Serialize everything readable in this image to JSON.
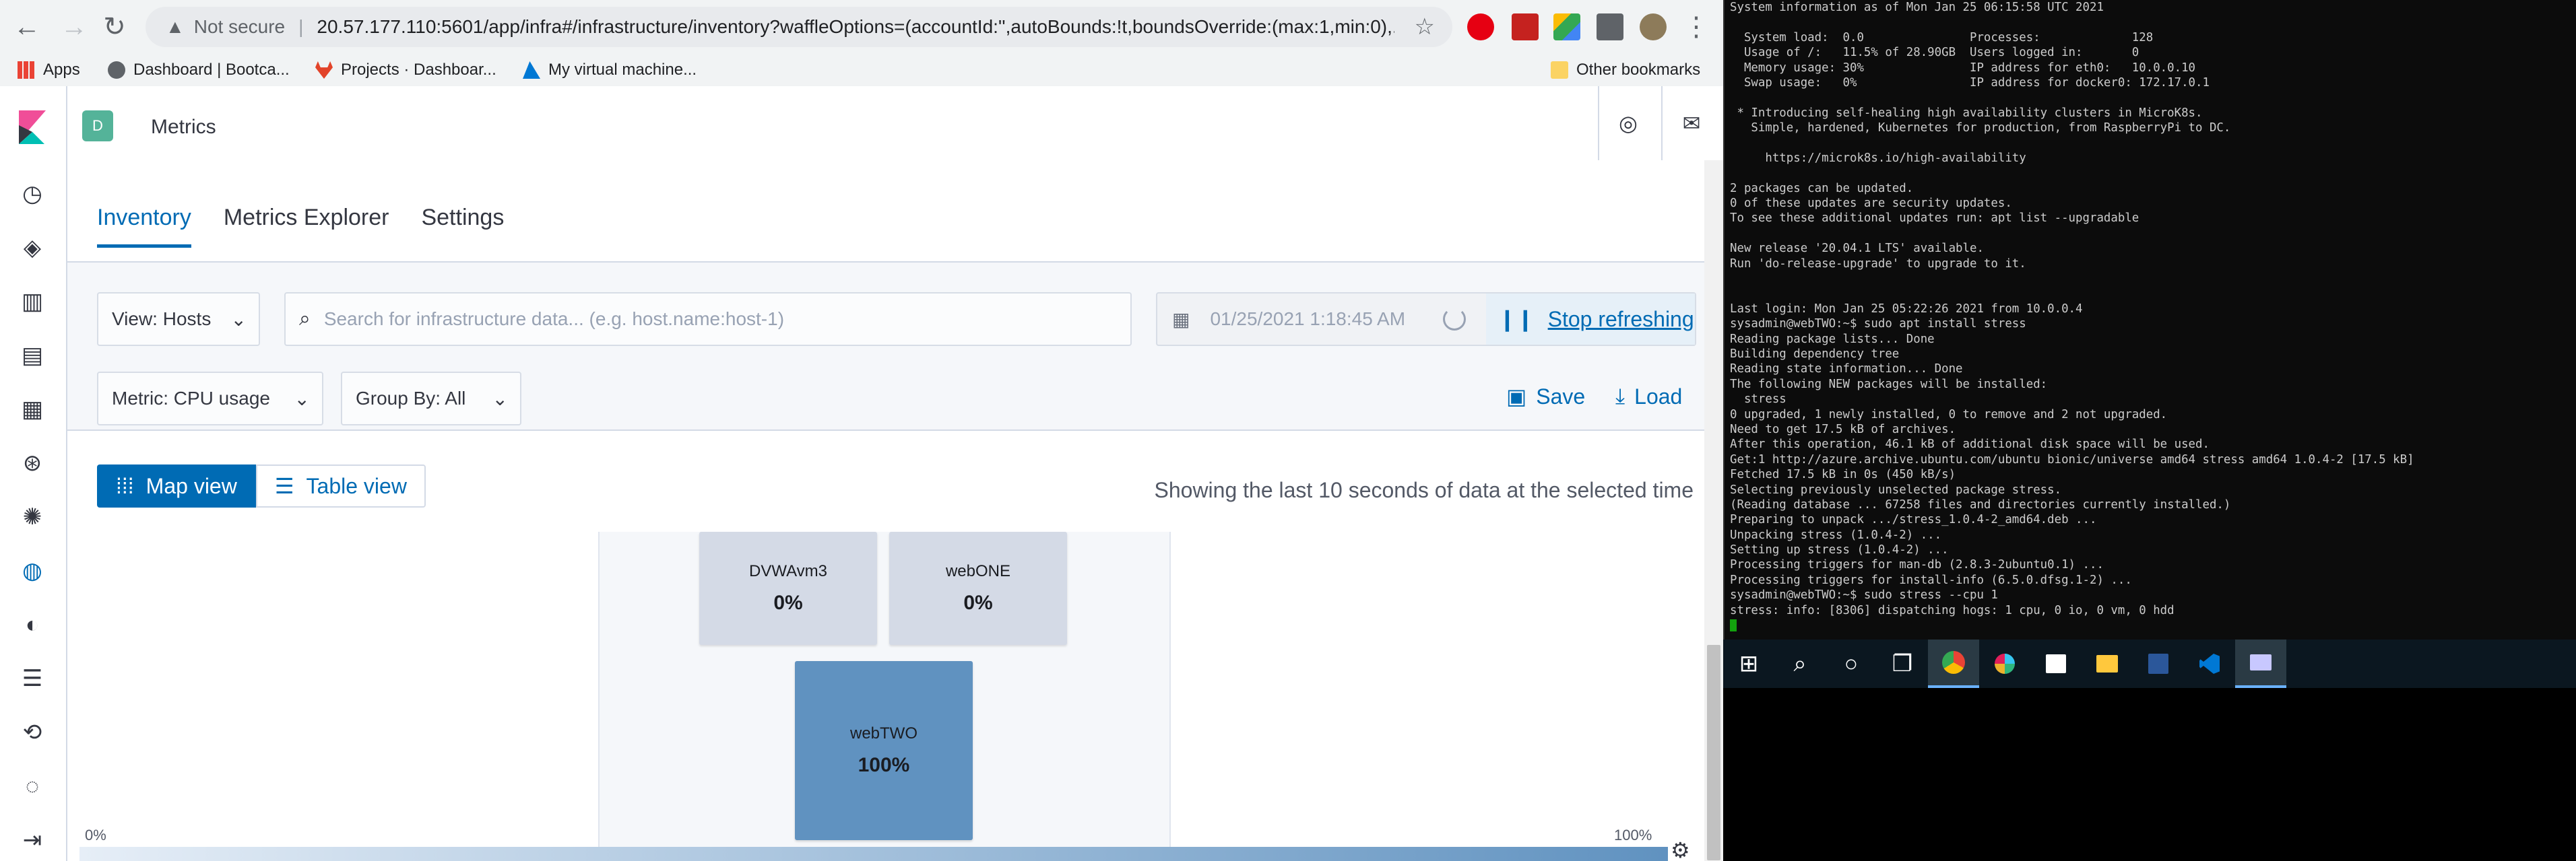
{
  "browser": {
    "not_secure": "Not secure",
    "url": "20.57.177.110:5601/app/infra#/infrastructure/inventory?waffleOptions=(accountId:'',autoBounds:!t,boundsOverride:(max:1,min:0),...",
    "bookmarks": [
      {
        "label": "Apps"
      },
      {
        "label": "Dashboard | Bootca..."
      },
      {
        "label": "Projects · Dashboar..."
      },
      {
        "label": "My virtual machine..."
      }
    ],
    "other_bookmarks": "Other bookmarks"
  },
  "header": {
    "space_initial": "D",
    "breadcrumb": "Metrics"
  },
  "tabs": [
    {
      "label": "Inventory",
      "active": true
    },
    {
      "label": "Metrics Explorer",
      "active": false
    },
    {
      "label": "Settings",
      "active": false
    }
  ],
  "toolbar": {
    "view_label": "View: Hosts",
    "search_placeholder": "Search for infrastructure data... (e.g. host.name:host-1)",
    "date_value": "01/25/2021 1:18:45 AM",
    "stop_refreshing": "Stop refreshing",
    "metric_label": "Metric: CPU usage",
    "group_by_label": "Group By: All",
    "save_label": "Save",
    "load_label": "Load"
  },
  "view_toggle": {
    "map_view": "Map view",
    "table_view": "Table view"
  },
  "status_text": "Showing the last 10 seconds of data at the selected time",
  "nodes": [
    {
      "name": "DVWAvm3",
      "value": "0%"
    },
    {
      "name": "webONE",
      "value": "0%"
    },
    {
      "name": "webTWO",
      "value": "100%"
    }
  ],
  "legend": {
    "min": "0%",
    "max": "100%"
  },
  "colors": {
    "accent": "#006bb4",
    "node_low": "#d4dae6",
    "node_high": "#6092c0",
    "space_badge": "#54b399"
  },
  "terminal_lines": [
    "System information as of Mon Jan 25 06:15:58 UTC 2021",
    "",
    "  System load:  0.0               Processes:             128",
    "  Usage of /:   11.5% of 28.90GB  Users logged in:       0",
    "  Memory usage: 30%               IP address for eth0:   10.0.0.10",
    "  Swap usage:   0%                IP address for docker0: 172.17.0.1",
    "",
    " * Introducing self-healing high availability clusters in MicroK8s.",
    "   Simple, hardened, Kubernetes for production, from RaspberryPi to DC.",
    "",
    "     https://microk8s.io/high-availability",
    "",
    "2 packages can be updated.",
    "0 of these updates are security updates.",
    "To see these additional updates run: apt list --upgradable",
    "",
    "New release '20.04.1 LTS' available.",
    "Run 'do-release-upgrade' to upgrade to it.",
    "",
    "",
    "Last login: Mon Jan 25 05:22:26 2021 from 10.0.0.4",
    "sysadmin@webTWO:~$ sudo apt install stress",
    "Reading package lists... Done",
    "Building dependency tree",
    "Reading state information... Done",
    "The following NEW packages will be installed:",
    "  stress",
    "0 upgraded, 1 newly installed, 0 to remove and 2 not upgraded.",
    "Need to get 17.5 kB of archives.",
    "After this operation, 46.1 kB of additional disk space will be used.",
    "Get:1 http://azure.archive.ubuntu.com/ubuntu bionic/universe amd64 stress amd64 1.0.4-2 [17.5 kB]",
    "Fetched 17.5 kB in 0s (450 kB/s)",
    "Selecting previously unselected package stress.",
    "(Reading database ... 67258 files and directories currently installed.)",
    "Preparing to unpack .../stress_1.0.4-2_amd64.deb ...",
    "Unpacking stress (1.0.4-2) ...",
    "Setting up stress (1.0.4-2) ...",
    "Processing triggers for man-db (2.8.3-2ubuntu0.1) ...",
    "Processing triggers for install-info (6.5.0.dfsg.1-2) ...",
    "sysadmin@webTWO:~$ sudo stress --cpu 1",
    "stress: info: [8306] dispatching hogs: 1 cpu, 0 io, 0 vm, 0 hdd"
  ]
}
